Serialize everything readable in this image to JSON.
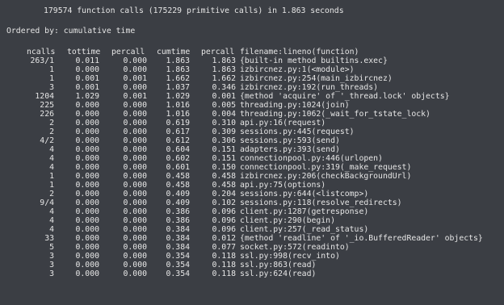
{
  "summary": "179574 function calls (175229 primitive calls) in 1.863 seconds",
  "ordered_by": "Ordered by: cumulative time",
  "columns": {
    "ncalls": "ncalls",
    "tottime": "tottime",
    "percall1": "percall",
    "cumtime": "cumtime",
    "percall2": "percall",
    "filename": "filename:lineno(function)"
  },
  "rows": [
    {
      "ncalls": "263/1",
      "tottime": "0.011",
      "percall1": "0.000",
      "cumtime": "1.863",
      "percall2": "1.863",
      "fn": "{built-in method builtins.exec}"
    },
    {
      "ncalls": "1",
      "tottime": "0.000",
      "percall1": "0.000",
      "cumtime": "1.863",
      "percall2": "1.863",
      "fn": "izbircnez.py:1(<module>)"
    },
    {
      "ncalls": "1",
      "tottime": "0.001",
      "percall1": "0.001",
      "cumtime": "1.662",
      "percall2": "1.662",
      "fn": "izbircnez.py:254(main_izbircnez)"
    },
    {
      "ncalls": "3",
      "tottime": "0.001",
      "percall1": "0.000",
      "cumtime": "1.037",
      "percall2": "0.346",
      "fn": "izbircnez.py:192(run_threads)"
    },
    {
      "ncalls": "1204",
      "tottime": "1.029",
      "percall1": "0.001",
      "cumtime": "1.029",
      "percall2": "0.001",
      "fn": "{method 'acquire' of '_thread.lock' objects}"
    },
    {
      "ncalls": "225",
      "tottime": "0.000",
      "percall1": "0.000",
      "cumtime": "1.016",
      "percall2": "0.005",
      "fn": "threading.py:1024(join)"
    },
    {
      "ncalls": "226",
      "tottime": "0.000",
      "percall1": "0.000",
      "cumtime": "1.016",
      "percall2": "0.004",
      "fn": "threading.py:1062(_wait_for_tstate_lock)"
    },
    {
      "ncalls": "2",
      "tottime": "0.000",
      "percall1": "0.000",
      "cumtime": "0.619",
      "percall2": "0.310",
      "fn": "api.py:16(request)"
    },
    {
      "ncalls": "2",
      "tottime": "0.000",
      "percall1": "0.000",
      "cumtime": "0.617",
      "percall2": "0.309",
      "fn": "sessions.py:445(request)"
    },
    {
      "ncalls": "4/2",
      "tottime": "0.000",
      "percall1": "0.000",
      "cumtime": "0.612",
      "percall2": "0.306",
      "fn": "sessions.py:593(send)"
    },
    {
      "ncalls": "4",
      "tottime": "0.000",
      "percall1": "0.000",
      "cumtime": "0.604",
      "percall2": "0.151",
      "fn": "adapters.py:393(send)"
    },
    {
      "ncalls": "4",
      "tottime": "0.000",
      "percall1": "0.000",
      "cumtime": "0.602",
      "percall2": "0.151",
      "fn": "connectionpool.py:446(urlopen)"
    },
    {
      "ncalls": "4",
      "tottime": "0.000",
      "percall1": "0.000",
      "cumtime": "0.601",
      "percall2": "0.150",
      "fn": "connectionpool.py:319(_make_request)"
    },
    {
      "ncalls": "1",
      "tottime": "0.000",
      "percall1": "0.000",
      "cumtime": "0.458",
      "percall2": "0.458",
      "fn": "izbircnez.py:206(checkBackgroundUrl)"
    },
    {
      "ncalls": "1",
      "tottime": "0.000",
      "percall1": "0.000",
      "cumtime": "0.458",
      "percall2": "0.458",
      "fn": "api.py:75(options)"
    },
    {
      "ncalls": "2",
      "tottime": "0.000",
      "percall1": "0.000",
      "cumtime": "0.409",
      "percall2": "0.204",
      "fn": "sessions.py:644(<listcomp>)"
    },
    {
      "ncalls": "9/4",
      "tottime": "0.000",
      "percall1": "0.000",
      "cumtime": "0.409",
      "percall2": "0.102",
      "fn": "sessions.py:118(resolve_redirects)"
    },
    {
      "ncalls": "4",
      "tottime": "0.000",
      "percall1": "0.000",
      "cumtime": "0.386",
      "percall2": "0.096",
      "fn": "client.py:1287(getresponse)"
    },
    {
      "ncalls": "4",
      "tottime": "0.000",
      "percall1": "0.000",
      "cumtime": "0.386",
      "percall2": "0.096",
      "fn": "client.py:290(begin)"
    },
    {
      "ncalls": "4",
      "tottime": "0.000",
      "percall1": "0.000",
      "cumtime": "0.384",
      "percall2": "0.096",
      "fn": "client.py:257(_read_status)"
    },
    {
      "ncalls": "33",
      "tottime": "0.000",
      "percall1": "0.000",
      "cumtime": "0.384",
      "percall2": "0.012",
      "fn": "{method 'readline' of '_io.BufferedReader' objects}"
    },
    {
      "ncalls": "5",
      "tottime": "0.000",
      "percall1": "0.000",
      "cumtime": "0.384",
      "percall2": "0.077",
      "fn": "socket.py:572(readinto)"
    },
    {
      "ncalls": "3",
      "tottime": "0.000",
      "percall1": "0.000",
      "cumtime": "0.354",
      "percall2": "0.118",
      "fn": "ssl.py:998(recv_into)"
    },
    {
      "ncalls": "3",
      "tottime": "0.000",
      "percall1": "0.000",
      "cumtime": "0.354",
      "percall2": "0.118",
      "fn": "ssl.py:863(read)"
    },
    {
      "ncalls": "3",
      "tottime": "0.000",
      "percall1": "0.000",
      "cumtime": "0.354",
      "percall2": "0.118",
      "fn": "ssl.py:624(read)"
    }
  ]
}
